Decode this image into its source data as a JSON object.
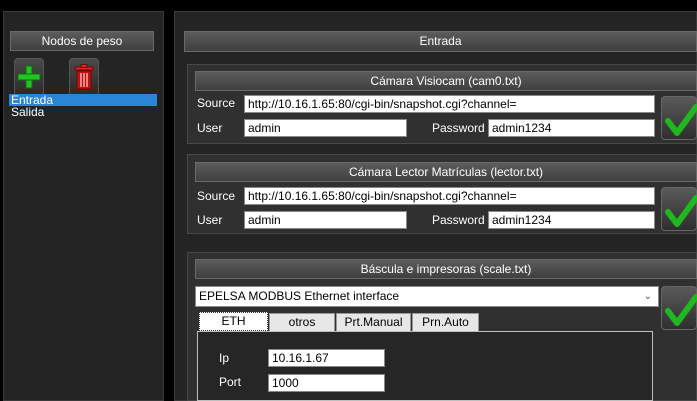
{
  "left": {
    "title": "Nodos de peso",
    "add_icon": "plus-icon",
    "delete_icon": "trash-icon",
    "nodes": [
      {
        "label": "Entrada",
        "selected": true
      },
      {
        "label": "Salida",
        "selected": false
      }
    ]
  },
  "main": {
    "title": "Entrada",
    "camera1": {
      "title": "Cámara Visiocam (cam0.txt)",
      "source_label": "Source",
      "source_value": "http://10.16.1.65:80/cgi-bin/snapshot.cgi?channel=",
      "user_label": "User",
      "user_value": "admin",
      "password_label": "Password",
      "password_value": "admin1234"
    },
    "camera2": {
      "title": "Cámara Lector Matrículas (lector.txt)",
      "source_label": "Source",
      "source_value": "http://10.16.1.65:80/cgi-bin/snapshot.cgi?channel=",
      "user_label": "User",
      "user_value": "admin",
      "password_label": "Password",
      "password_value": "admin1234"
    },
    "scale": {
      "title": "Báscula e impresoras (scale.txt)",
      "interface_selected": "EPELSA MODBUS Ethernet interface",
      "tabs": [
        "ETH",
        "otros",
        "Prt.Manual",
        "Prn.Auto"
      ],
      "active_tab": "ETH",
      "ip_label": "Ip",
      "ip_value": "10.16.1.67",
      "port_label": "Port",
      "port_value": "1000"
    }
  },
  "colors": {
    "selection": "#2a85d6",
    "accept_green": "#1fb81f",
    "add_green": "#22c422",
    "delete_red": "#c01010"
  }
}
